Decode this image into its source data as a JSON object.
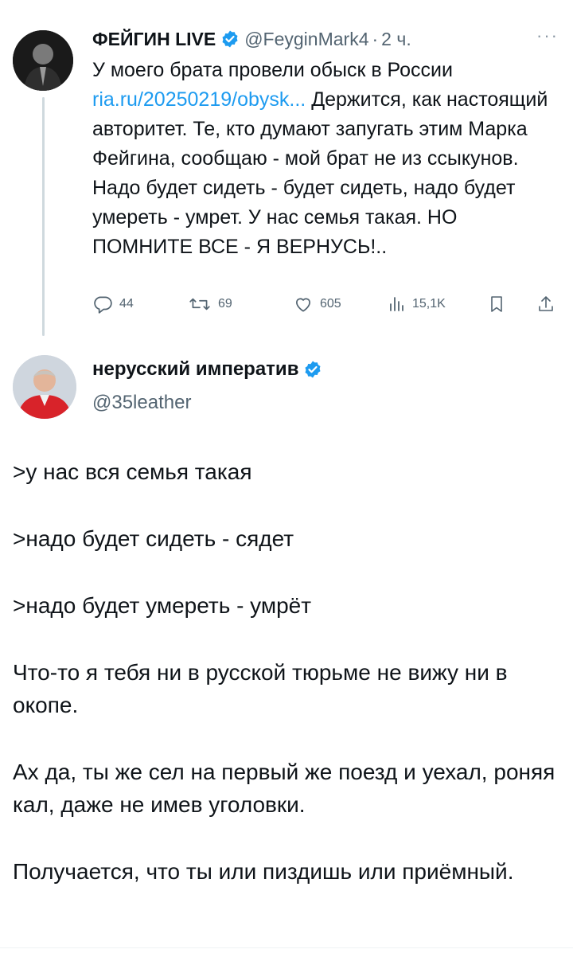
{
  "quoted_tweet": {
    "author_name": "ФЕЙГИН LIVE",
    "handle": "@FeyginMark4",
    "separator": "·",
    "time": "2 ч.",
    "more": "···",
    "text_line1": "У моего брата провели обыск в России",
    "link": "ria.ru/20250219/obysk...",
    "text_after_link": "Держится, как настоящий авторитет. Те, кто думают запугать этим Марка Фейгина, сообщаю - мой брат не из ссыкунов. Надо будет сидеть - будет сидеть, надо будет умереть - умрет. У нас семья такая. НО ПОМНИТЕ ВСЕ - Я ВЕРНУСЬ!..",
    "stats": {
      "replies": "44",
      "reposts": "69",
      "likes": "605",
      "views": "15,1K"
    },
    "icons": [
      "reply-icon",
      "repost-icon",
      "like-icon",
      "views-icon",
      "bookmark-icon",
      "share-icon"
    ],
    "colors": {
      "link": "#1d9bf0",
      "verified": "#1d9bf0",
      "muted": "#536471"
    }
  },
  "reply_tweet": {
    "author_name": "нерусский императив",
    "handle": "@35leather",
    "paragraphs": [
      ">у нас вся семья такая",
      ">надо будет сидеть - сядет",
      ">надо будет умереть - умрёт",
      "Что-то я тебя ни в русской тюрьме не вижу ни в окопе.",
      "Ах да, ты же сел на первый же поезд и уехал, роняя кал, даже не имев уголовки.",
      "Получается, что ты или пиздишь или приёмный."
    ]
  }
}
